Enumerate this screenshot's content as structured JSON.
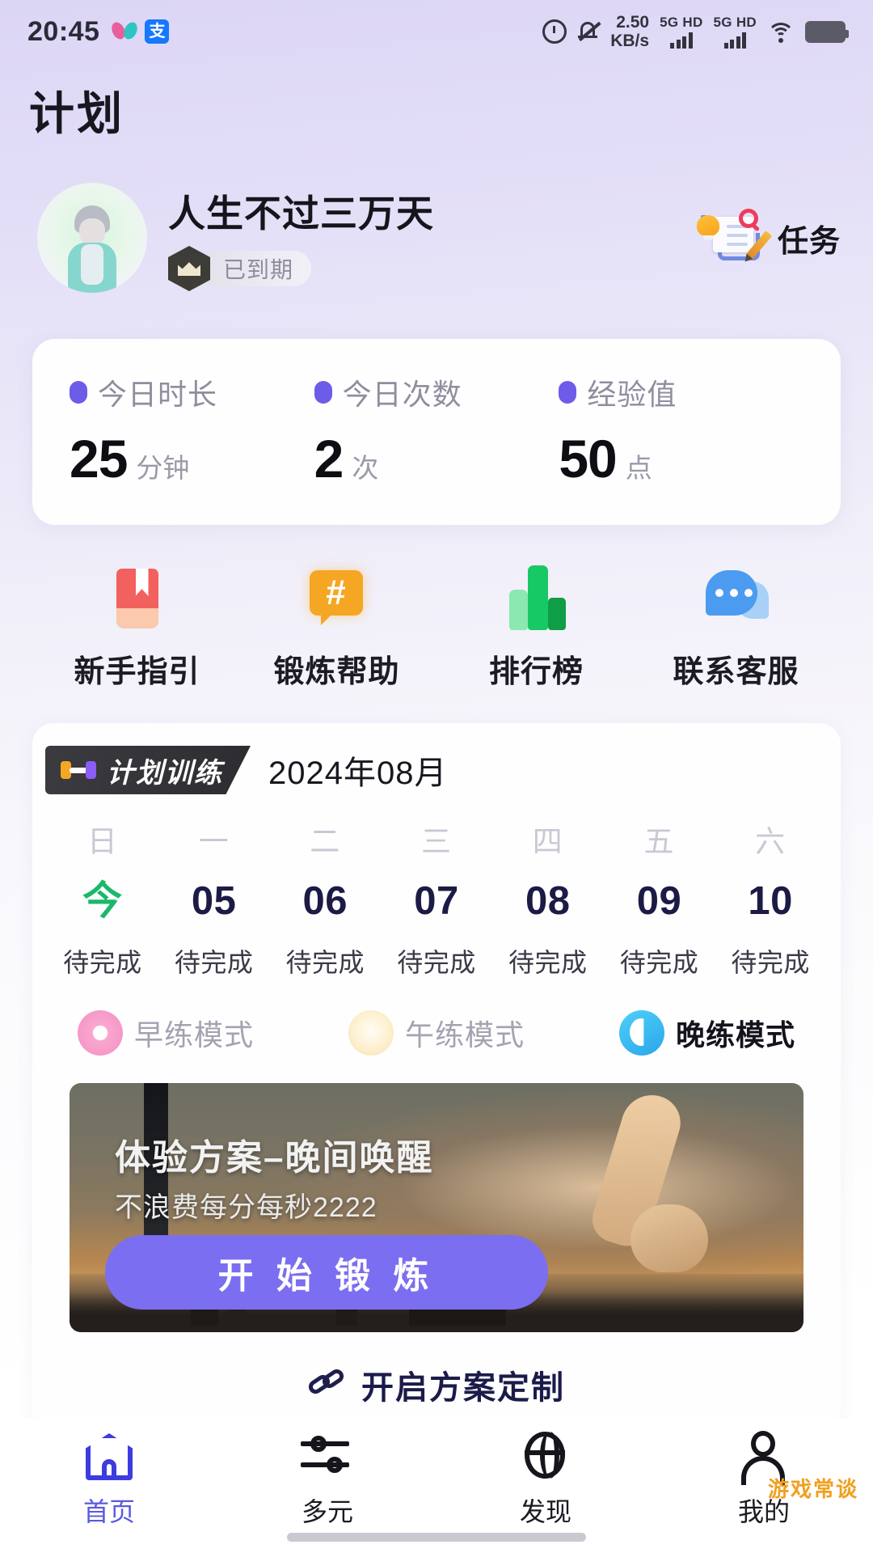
{
  "status_bar": {
    "time": "20:45",
    "icons_left": [
      "flower-icon",
      "alipay-icon"
    ],
    "network_speed": "2.50",
    "network_speed_unit": "KB/s",
    "sim1_label": "5G HD",
    "sim2_label": "5G HD",
    "icons_right": [
      "alarm-icon",
      "mute-icon",
      "wifi-icon",
      "battery-icon"
    ]
  },
  "page": {
    "title": "计划"
  },
  "profile": {
    "name": "人生不过三万天",
    "badge_text": "已到期",
    "badge_icon": "crown-icon",
    "task_label": "任务",
    "task_icon": "task-checklist-icon"
  },
  "stats": [
    {
      "label": "今日时长",
      "value": "25",
      "unit": "分钟"
    },
    {
      "label": "今日次数",
      "value": "2",
      "unit": "次"
    },
    {
      "label": "经验值",
      "value": "50",
      "unit": "点"
    }
  ],
  "quick_actions": [
    {
      "label": "新手指引",
      "icon": "book-icon"
    },
    {
      "label": "锻炼帮助",
      "icon": "hash-bubble-icon"
    },
    {
      "label": "排行榜",
      "icon": "bar-chart-icon"
    },
    {
      "label": "联系客服",
      "icon": "chat-bubble-icon"
    }
  ],
  "plan": {
    "tag_label": "计划训练",
    "tag_icon": "dumbbell-icon",
    "month": "2024年08月",
    "weekdays": [
      "日",
      "一",
      "二",
      "三",
      "四",
      "五",
      "六"
    ],
    "days": [
      {
        "day": "今",
        "status": "待完成",
        "is_today": true
      },
      {
        "day": "05",
        "status": "待完成",
        "is_today": false
      },
      {
        "day": "06",
        "status": "待完成",
        "is_today": false
      },
      {
        "day": "07",
        "status": "待完成",
        "is_today": false
      },
      {
        "day": "08",
        "status": "待完成",
        "is_today": false
      },
      {
        "day": "09",
        "status": "待完成",
        "is_today": false
      },
      {
        "day": "10",
        "status": "待完成",
        "is_today": false
      }
    ],
    "modes": [
      {
        "label": "早练模式",
        "icon": "donut-icon",
        "active": false
      },
      {
        "label": "午练模式",
        "icon": "sun-icon",
        "active": false
      },
      {
        "label": "晚练模式",
        "icon": "moon-icon",
        "active": true
      }
    ],
    "banner": {
      "title": "体验方案–晚间唤醒",
      "subtitle": "不浪费每分每秒2222",
      "button_label": "开 始 锻 炼"
    },
    "custom_link_label": "开启方案定制",
    "custom_link_icon": "link-icon"
  },
  "bottom_nav": [
    {
      "label": "首页",
      "icon": "home-icon",
      "active": true
    },
    {
      "label": "多元",
      "icon": "sliders-icon",
      "active": false
    },
    {
      "label": "发现",
      "icon": "globe-icon",
      "active": false
    },
    {
      "label": "我的",
      "icon": "person-icon",
      "active": false
    }
  ],
  "watermark": "游戏常谈",
  "colors": {
    "accent_purple": "#6c5ce7",
    "button_purple": "#7b6ef0",
    "today_green": "#1bb86a",
    "nav_active": "#5a5ae0",
    "day_navy": "#1b1b45"
  }
}
